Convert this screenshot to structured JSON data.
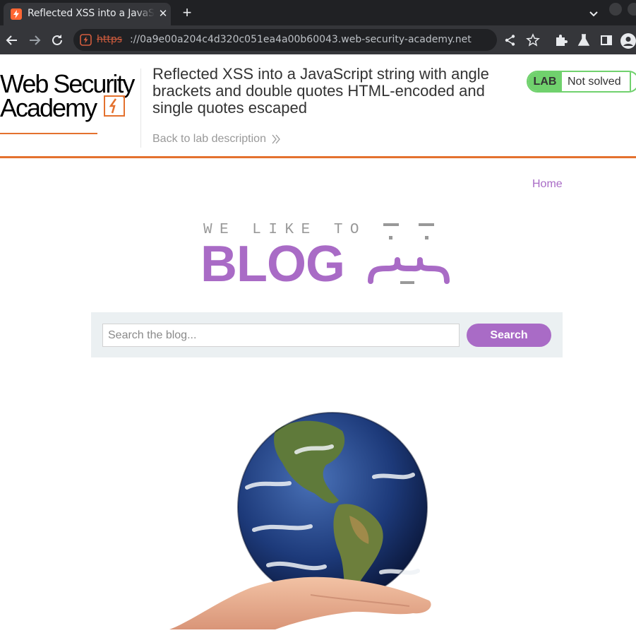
{
  "browser": {
    "tab_title": "Reflected XSS into a JavaScript string with angle brackets and double quotes HTML-encoded and single quotes escaped",
    "tab_close": "✕",
    "new_tab": "+",
    "url_scheme": "https",
    "url_rest": "://0a9e00a204c4d320c051ea4a00b60043.web-security-academy.net"
  },
  "lab_header": {
    "logo_line1": "Web Security",
    "logo_line2": "Academy",
    "title": "Reflected XSS into a JavaScript string with angle brackets and double quotes HTML-encoded and single quotes escaped",
    "back_link": "Back to lab description",
    "status_tag": "LAB",
    "status_text": "Not solved"
  },
  "blog": {
    "nav_home": "Home",
    "tagline": "WE LIKE TO",
    "brand": "BLOG",
    "search": {
      "placeholder": "Search the blog...",
      "value": "",
      "button_label": "Search"
    }
  },
  "colors": {
    "accent_purple": "#a96bc6",
    "accent_orange": "#e4712e",
    "status_green": "#70d16d",
    "chrome_dark": "#202124",
    "chrome_toolbar": "#35363a"
  },
  "icons": [
    "favicon-icon",
    "close-icon",
    "plus-icon",
    "back-arrow-icon",
    "forward-arrow-icon",
    "reload-icon",
    "not-secure-icon",
    "share-icon",
    "star-icon",
    "extensions-icon",
    "flask-icon",
    "side-panel-icon",
    "profile-icon",
    "chevron-double-right-icon"
  ]
}
